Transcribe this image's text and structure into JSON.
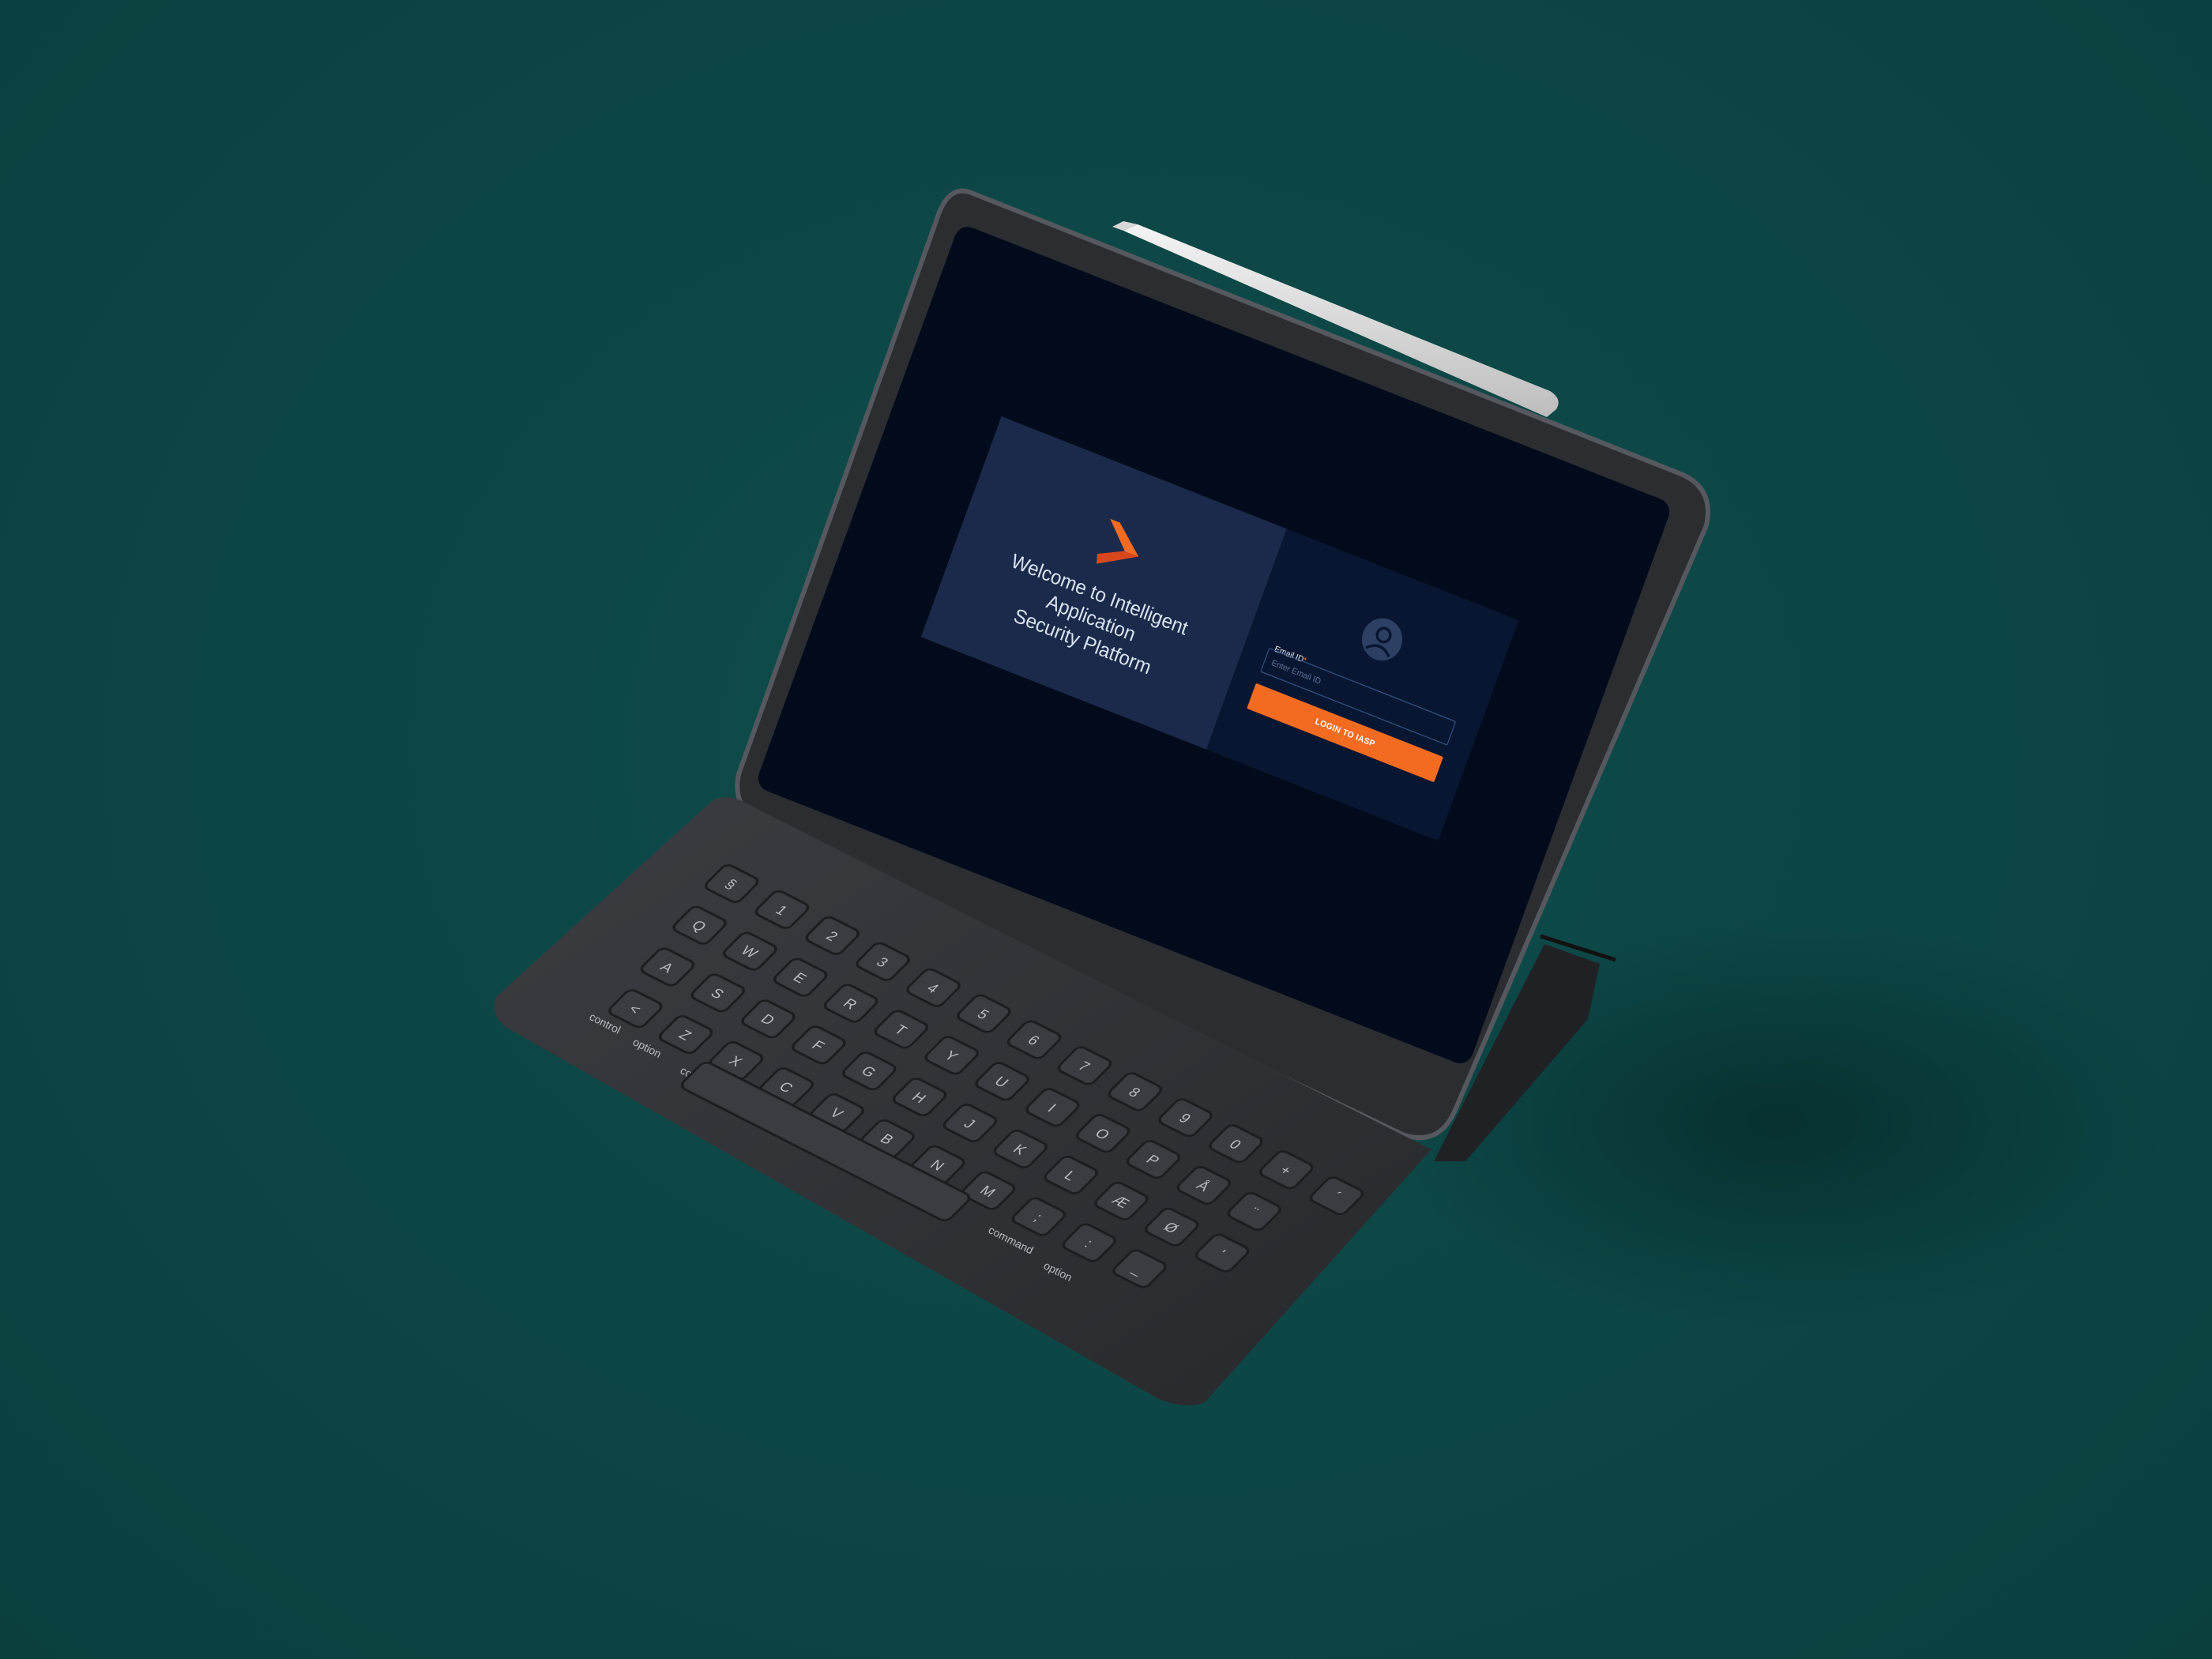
{
  "welcome": {
    "title_line1": "Welcome to Intelligent Application",
    "title_line2": "Security Platform"
  },
  "login": {
    "email_label": "Email ID",
    "email_required_mark": "*",
    "email_placeholder": "Enter Email ID",
    "button_label": "LOGIN TO IASP"
  },
  "colors": {
    "background": "#0c4645",
    "screen": "#020b1b",
    "welcome_panel": "#1b2a4a",
    "login_panel": "#081631",
    "accent": "#f26b21"
  },
  "keyboard": {
    "rows": [
      [
        "§",
        "1",
        "2",
        "3",
        "4",
        "5",
        "6",
        "7",
        "8",
        "9",
        "0",
        "+",
        "´"
      ],
      [
        "Q",
        "W",
        "E",
        "R",
        "T",
        "Y",
        "U",
        "I",
        "O",
        "P",
        "Å",
        "¨"
      ],
      [
        "A",
        "S",
        "D",
        "F",
        "G",
        "H",
        "J",
        "K",
        "L",
        "Æ",
        "Ø",
        "'"
      ],
      [
        "<",
        "Z",
        "X",
        "C",
        "V",
        "B",
        "N",
        "M",
        ";",
        ":",
        "_"
      ]
    ],
    "modifiers": [
      "control",
      "option",
      "command",
      "command",
      "option"
    ]
  }
}
